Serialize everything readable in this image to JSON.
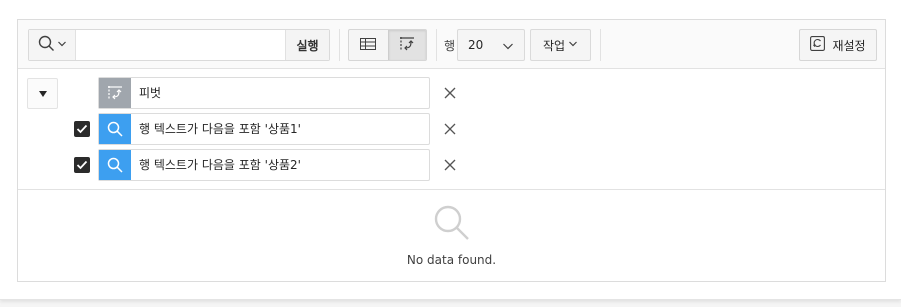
{
  "toolbar": {
    "search_column_icon": "search-icon",
    "search_value": "",
    "search_placeholder": "",
    "go_label": "실행",
    "view_icons": [
      "grid-view-icon",
      "pivot-view-icon"
    ],
    "active_view": "pivot",
    "rows_label": "행",
    "rows_value": "20",
    "actions_label": "작업",
    "reset_label": "재설정"
  },
  "filters": {
    "collapse_icon": "caret-down-icon",
    "items": [
      {
        "type": "pivot",
        "icon": "pivot-icon",
        "label": "피벗",
        "checkbox": false
      },
      {
        "type": "row-filter",
        "icon": "search-icon",
        "label": "행 텍스트가 다음을 포함 '상품1'",
        "checkbox": true,
        "checked": true
      },
      {
        "type": "row-filter",
        "icon": "search-icon",
        "label": "행 텍스트가 다음을 포함 '상품2'",
        "checkbox": true,
        "checked": true
      }
    ]
  },
  "empty_state": {
    "icon": "search-icon",
    "message": "No data found."
  },
  "colors": {
    "pivot_icon_bg": "#a0a6ad",
    "filter_icon_bg": "#3d9ff0",
    "checkbox_bg": "#2b2b2b"
  }
}
